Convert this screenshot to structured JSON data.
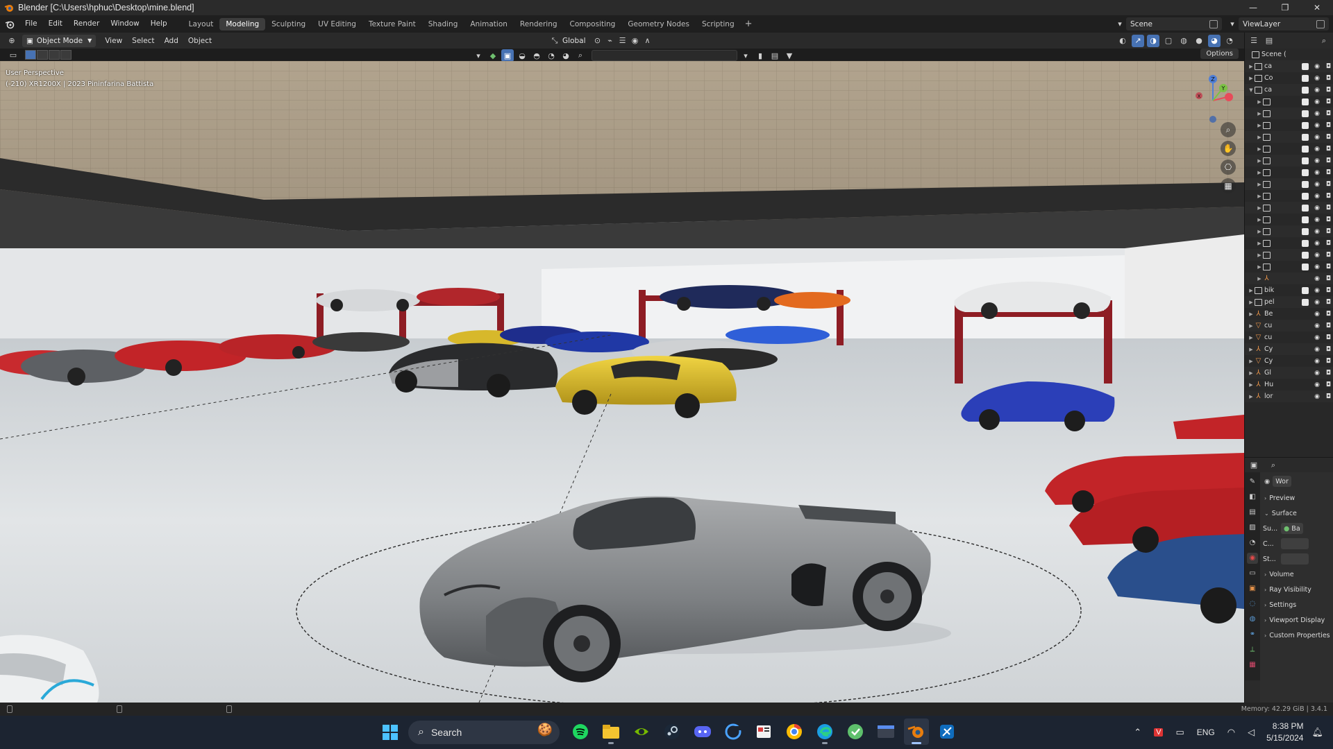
{
  "window": {
    "title": "Blender [C:\\Users\\hphuc\\Desktop\\mine.blend]",
    "controls": {
      "minimize": "—",
      "maximize": "❐",
      "close": "✕"
    }
  },
  "menubar": {
    "menus": [
      "File",
      "Edit",
      "Render",
      "Window",
      "Help"
    ],
    "workspaces": [
      "Layout",
      "Modeling",
      "Sculpting",
      "UV Editing",
      "Texture Paint",
      "Shading",
      "Animation",
      "Rendering",
      "Compositing",
      "Geometry Nodes",
      "Scripting"
    ],
    "active_workspace": "Modeling",
    "add_workspace": "+",
    "scene_name": "Scene",
    "view_layer": "ViewLayer"
  },
  "viewport_header": {
    "mode": "Object Mode",
    "menus": [
      "View",
      "Select",
      "Add",
      "Object"
    ],
    "orientation": "Global",
    "options_label": "Options"
  },
  "viewport": {
    "perspective_label": "User Perspective",
    "object_info": "(-210) XR1200X | 2023 Pininfarina Battista",
    "gizmo_axes": {
      "z": "Z",
      "y": "Y",
      "x": "X"
    },
    "colors": {
      "floor": "#d9dde0",
      "ceiling": "#a59985",
      "lift": "#8e1d24",
      "grey_car": "#8a8c8e",
      "yellow_car": "#e3c22b",
      "red_car": "#c22428",
      "blue_car": "#2b3fb8"
    }
  },
  "outliner": {
    "scene_label": "Scene (",
    "rows": [
      {
        "name": "ca",
        "type": "collection",
        "expanded": false,
        "checked": true
      },
      {
        "name": "Co",
        "type": "collection",
        "expanded": false,
        "checked": true
      },
      {
        "name": "ca",
        "type": "collection",
        "expanded": true,
        "checked": true
      },
      {
        "name": "",
        "type": "collection",
        "expanded": false,
        "checked": true
      },
      {
        "name": "",
        "type": "collection",
        "expanded": false,
        "checked": true
      },
      {
        "name": "",
        "type": "collection",
        "expanded": false,
        "checked": true
      },
      {
        "name": "",
        "type": "collection",
        "expanded": false,
        "checked": true
      },
      {
        "name": "",
        "type": "collection",
        "expanded": false,
        "checked": true
      },
      {
        "name": "",
        "type": "collection",
        "expanded": false,
        "checked": true
      },
      {
        "name": "",
        "type": "collection",
        "expanded": false,
        "checked": true
      },
      {
        "name": "",
        "type": "collection",
        "expanded": false,
        "checked": true
      },
      {
        "name": "",
        "type": "collection",
        "expanded": false,
        "checked": true
      },
      {
        "name": "",
        "type": "collection",
        "expanded": false,
        "checked": true
      },
      {
        "name": "",
        "type": "collection",
        "expanded": false,
        "checked": true
      },
      {
        "name": "",
        "type": "collection",
        "expanded": false,
        "checked": true
      },
      {
        "name": "",
        "type": "collection",
        "expanded": false,
        "checked": true
      },
      {
        "name": "",
        "type": "collection",
        "expanded": false,
        "checked": true
      },
      {
        "name": "",
        "type": "collection",
        "expanded": false,
        "checked": true
      },
      {
        "name": "",
        "type": "object",
        "expanded": false,
        "checked": false
      },
      {
        "name": "bik",
        "type": "collection",
        "expanded": false,
        "checked": true
      },
      {
        "name": "pel",
        "type": "collection",
        "expanded": false,
        "checked": true
      },
      {
        "name": "Be",
        "type": "object",
        "expanded": false,
        "checked": false
      },
      {
        "name": "cu",
        "type": "mesh",
        "expanded": false,
        "checked": false
      },
      {
        "name": "cu",
        "type": "mesh",
        "expanded": false,
        "checked": false
      },
      {
        "name": "Cy",
        "type": "object",
        "expanded": false,
        "checked": false
      },
      {
        "name": "Cy",
        "type": "mesh",
        "expanded": false,
        "checked": false
      },
      {
        "name": "Gl",
        "type": "object",
        "expanded": false,
        "checked": false
      },
      {
        "name": "Hu",
        "type": "object",
        "expanded": false,
        "checked": false
      },
      {
        "name": "lor",
        "type": "object",
        "expanded": false,
        "checked": false
      }
    ]
  },
  "properties": {
    "world_name": "Wor",
    "sections": [
      {
        "label": "Preview",
        "open": false
      },
      {
        "label": "Surface",
        "open": true
      }
    ],
    "surface_fields": {
      "su_label": "Su...",
      "su_value": "Ba",
      "c_label": "C...",
      "st_label": "St..."
    },
    "more_sections": [
      "Volume",
      "Ray Visibility",
      "Settings",
      "Viewport Display",
      "Custom Properties"
    ]
  },
  "statusbar": {
    "memory": "Memory: 42.29 GiB | 3.4.1"
  },
  "taskbar": {
    "search_placeholder": "Search",
    "apps": [
      "spotify",
      "file-explorer",
      "nvidia",
      "steam",
      "discord",
      "outlook-like",
      "gallery",
      "chrome-like",
      "edge",
      "git-like",
      "terminal",
      "blender",
      "snipping"
    ],
    "language": "ENG",
    "time": "8:38 PM",
    "date": "5/15/2024"
  }
}
